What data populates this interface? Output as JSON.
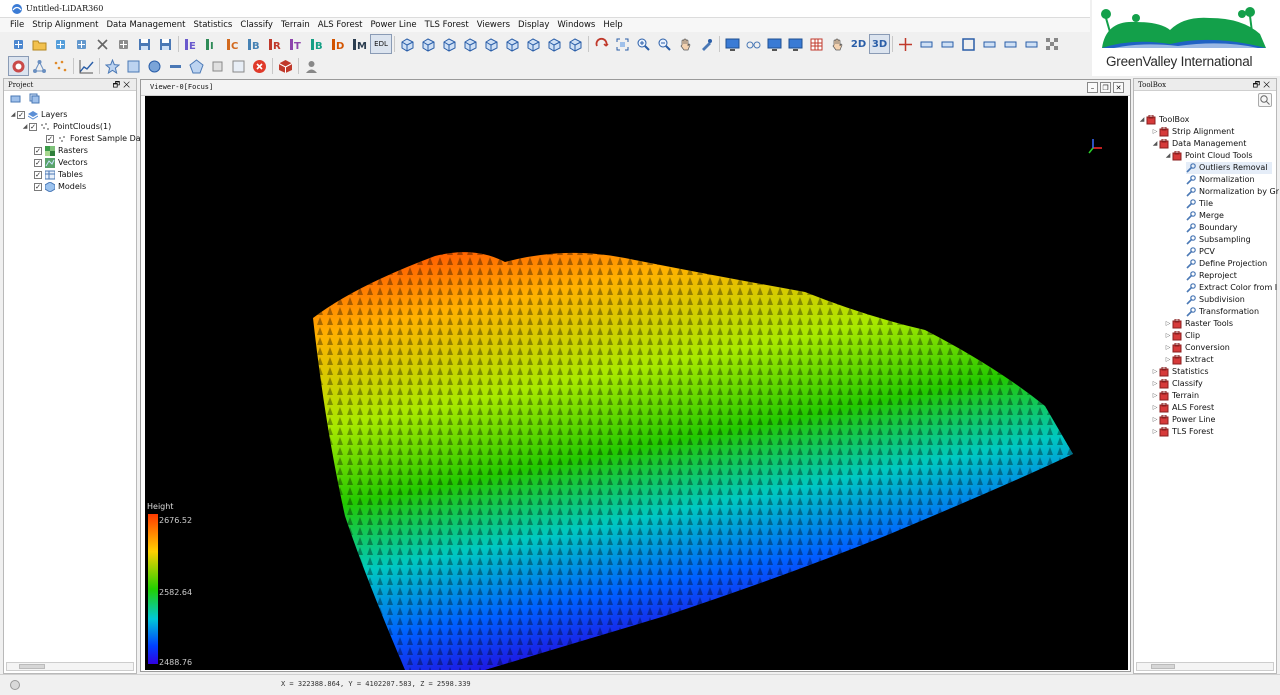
{
  "window": {
    "title": "Untitled-LiDAR360"
  },
  "menu": [
    "File",
    "Strip Alignment",
    "Data Management",
    "Statistics",
    "Classify",
    "Terrain",
    "ALS Forest",
    "Power Line",
    "TLS Forest",
    "Viewers",
    "Display",
    "Windows",
    "Help"
  ],
  "logo": {
    "text": "GreenValley International"
  },
  "toolbar1": {
    "icons": [
      "add-data-icon",
      "open-folder-icon",
      "add-point-icon",
      "add-measure-icon",
      "remove-icon",
      "new-file-icon",
      "save-icon",
      "save-as-icon",
      "class-e-icon",
      "class-i-icon",
      "class-c-icon",
      "class-b-icon",
      "class-r-icon",
      "class-t-icon",
      "class-b2-icon",
      "class-d-icon",
      "class-m-icon"
    ],
    "edl_label": "EDL",
    "view_icons": [
      "view-front-icon",
      "view-back-icon",
      "view-left-icon",
      "view-right-icon",
      "view-top-icon",
      "view-bottom-icon",
      "view-iso1-icon",
      "view-iso2-icon",
      "view-iso3-icon",
      "rotate-icon",
      "zoom-extent-icon",
      "zoom-in-icon",
      "zoom-out-icon",
      "pan-icon",
      "pick-icon",
      "monitor-icon",
      "glasses-icon",
      "screen-icon",
      "window-icon",
      "grid-icon",
      "pan-cube-icon"
    ],
    "mode_2d": "2D",
    "mode_3d": "3D"
  },
  "project": {
    "title": "Project",
    "layers_label": "Layers",
    "pointclouds_label": "PointClouds(1)",
    "forest_label": "Forest Sample Dat",
    "rasters_label": "Rasters",
    "vectors_label": "Vectors",
    "tables_label": "Tables",
    "models_label": "Models"
  },
  "viewer": {
    "tab_label": "Viewer-0[Focus]"
  },
  "legend": {
    "title": "Height",
    "max": "2676.52",
    "mid": "2582.64",
    "min": "2488.76"
  },
  "toolbox": {
    "title": "ToolBox",
    "root": "ToolBox",
    "items": [
      {
        "label": "Strip Alignment",
        "level": 1,
        "open": false
      },
      {
        "label": "Data Management",
        "level": 1,
        "open": true
      },
      {
        "label": "Point Cloud Tools",
        "level": 2,
        "open": true
      },
      {
        "label": "Outliers Removal",
        "level": 3,
        "selected": true
      },
      {
        "label": "Normalization",
        "level": 3
      },
      {
        "label": "Normalization by Gr",
        "level": 3
      },
      {
        "label": "Tile",
        "level": 3
      },
      {
        "label": "Merge",
        "level": 3
      },
      {
        "label": "Boundary",
        "level": 3
      },
      {
        "label": "Subsampling",
        "level": 3
      },
      {
        "label": "PCV",
        "level": 3
      },
      {
        "label": "Define Projection",
        "level": 3
      },
      {
        "label": "Reproject",
        "level": 3
      },
      {
        "label": "Extract Color from I",
        "level": 3
      },
      {
        "label": "Subdivision",
        "level": 3
      },
      {
        "label": "Transformation",
        "level": 3
      },
      {
        "label": "Raster Tools",
        "level": 2,
        "open": false
      },
      {
        "label": "Clip",
        "level": 2,
        "open": false
      },
      {
        "label": "Conversion",
        "level": 2,
        "open": false
      },
      {
        "label": "Extract",
        "level": 2,
        "open": false
      },
      {
        "label": "Statistics",
        "level": 1,
        "open": false
      },
      {
        "label": "Classify",
        "level": 1,
        "open": false
      },
      {
        "label": "Terrain",
        "level": 1,
        "open": false
      },
      {
        "label": "ALS Forest",
        "level": 1,
        "open": false
      },
      {
        "label": "Power Line",
        "level": 1,
        "open": false
      },
      {
        "label": "TLS Forest",
        "level": 1,
        "open": false
      }
    ]
  },
  "status": {
    "coordinates": "X = 322388.864, Y = 4102207.583, Z = 2598.339"
  },
  "colors": {
    "accent": "#2c6fd6",
    "logo_green": "#13a04a",
    "logo_blue": "#1f62c4"
  }
}
